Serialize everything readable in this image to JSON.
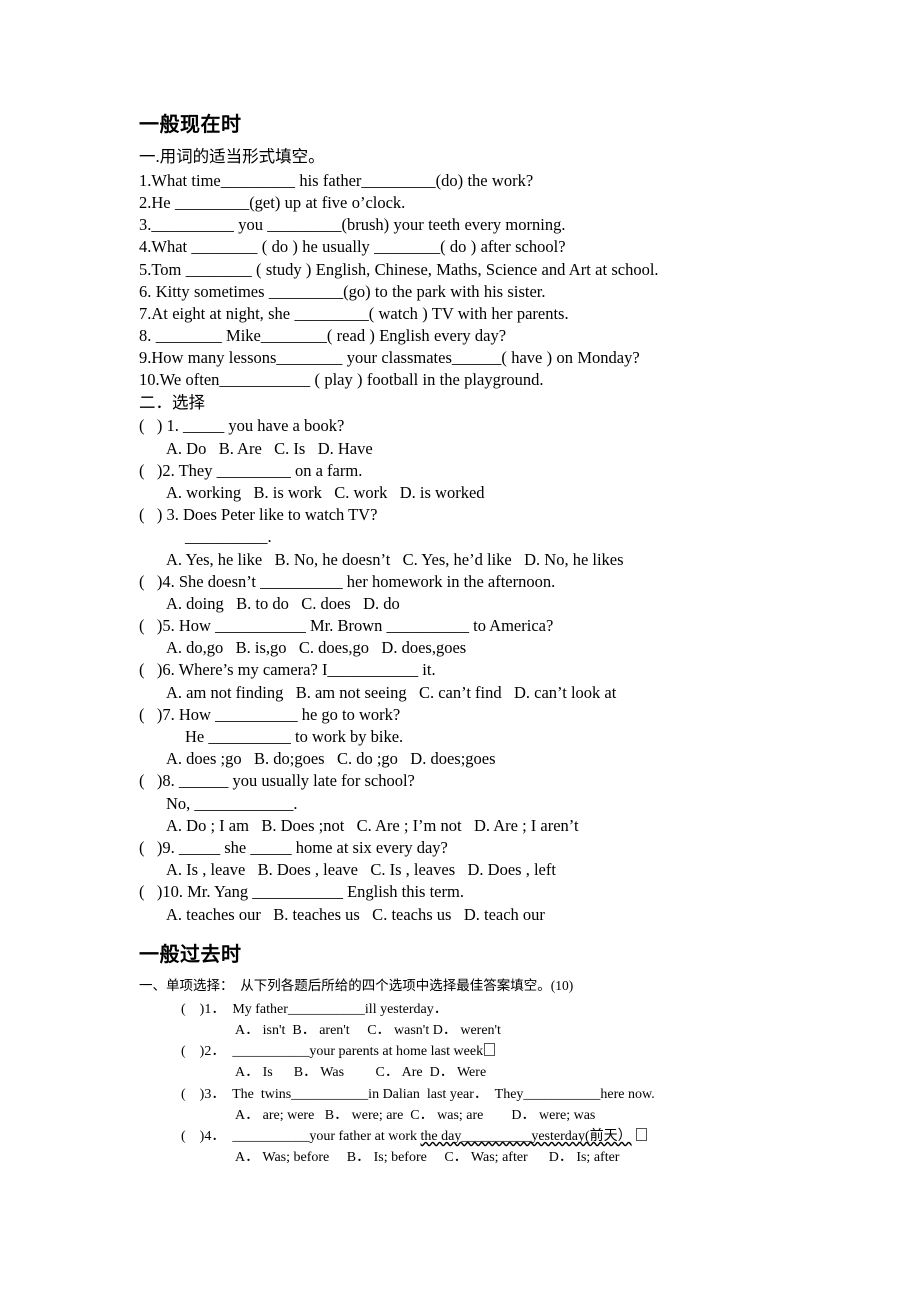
{
  "document": {
    "sections": [
      {
        "heading": "一般现在时",
        "part_one": {
          "intro": "一.用词的适当形式填空。",
          "items": [
            "1.What time_________ his father_________(do) the work?",
            "2.He _________(get) up at five o’clock.",
            "3.__________ you _________(brush) your teeth every morning.",
            "4.What ________ ( do ) he usually ________( do ) after school?",
            "5.Tom ________ ( study ) English, Chinese, Maths, Science and Art at school.",
            "6. Kitty sometimes _________(go) to the park with his sister.",
            "7.At eight at night, she _________( watch ) TV with her parents.",
            "8. ________ Mike________( read ) English every day?",
            "9.How many lessons________ your classmates______( have ) on Monday?",
            "10.We often___________ ( play ) football in the playground."
          ]
        },
        "part_two": {
          "intro": "二．选择",
          "questions": [
            {
              "stem": "(   ) 1. _____ you have a book?",
              "continuation": "",
              "answers": "A. Do   B. Are   C. Is   D. Have"
            },
            {
              "stem": "(   )2. They _________ on a farm.",
              "continuation": "",
              "answers": "A. working   B. is work   C. work   D. is worked"
            },
            {
              "stem": "(   ) 3. Does Peter like to watch TV?",
              "continuation": "__________.",
              "answers": "A. Yes, he like   B. No, he doesn’t   C. Yes, he’d like   D. No, he likes"
            },
            {
              "stem": "(   )4. She doesn’t __________ her homework in the afternoon.",
              "continuation": "",
              "answers": "A. doing   B. to do   C. does   D. do"
            },
            {
              "stem": "(   )5. How ___________ Mr. Brown __________ to America?",
              "continuation": "",
              "answers": "A. do,go   B. is,go   C. does,go   D. does,goes"
            },
            {
              "stem": "(   )6. Where’s my camera? I___________ it.",
              "continuation": "",
              "answers": "A. am not finding   B. am not seeing   C. can’t find   D. can’t look at"
            },
            {
              "stem": "(   )7. How __________ he go to work?",
              "continuation": "He __________ to work by bike.",
              "answers": "A. does ;go   B. do;goes   C. do ;go   D. does;goes"
            },
            {
              "stem": "(   )8. ______ you usually late for school?",
              "continuation": "No, ____________.",
              "answers": "A. Do ; I am   B. Does ;not   C. Are ; I’m not   D. Are ; I aren’t"
            },
            {
              "stem": "(   )9. _____ she _____ home at six every day?",
              "continuation": "",
              "answers": "A. Is , leave   B. Does , leave   C. Is , leaves   D. Does , left"
            },
            {
              "stem": "(   )10. Mr. Yang ___________ English this term.",
              "continuation": "",
              "answers": "A. teaches our   B. teaches us   C. teachs us   D. teach our"
            }
          ]
        }
      },
      {
        "heading": "一般过去时",
        "part_one": {
          "intro": "一、单项选择：  从下列各题后所给的四个选项中选择最佳答案填空。(10)",
          "questions": [
            {
              "stem_pre": "(    )1．  My father___________ill yesterday．",
              "stem_wavy": "",
              "stem_post": "",
              "tofu": false,
              "answers": "A． isn't  B． aren't     C． wasn't D． weren't"
            },
            {
              "stem_pre": "(    )2．  ___________your parents at home last week",
              "stem_wavy": "",
              "stem_post": "",
              "tofu": true,
              "answers": "A． Is      B． Was         C． Are  D． Were"
            },
            {
              "stem_pre": "(    )3．  The  twins___________in Dalian  last year．  They___________here now.",
              "stem_wavy": "",
              "stem_post": "",
              "tofu": false,
              "answers": "A． are; were   B． were; are  C． was; are        D． were; was"
            },
            {
              "stem_pre": "(    )4．  ___________your father at work ",
              "stem_wavy": "the day__________yesterday(前天）",
              "stem_post": " ",
              "tofu": true,
              "answers": "A． Was; before     B． Is; before     C． Was; after      D． Is; after"
            }
          ]
        }
      }
    ]
  }
}
